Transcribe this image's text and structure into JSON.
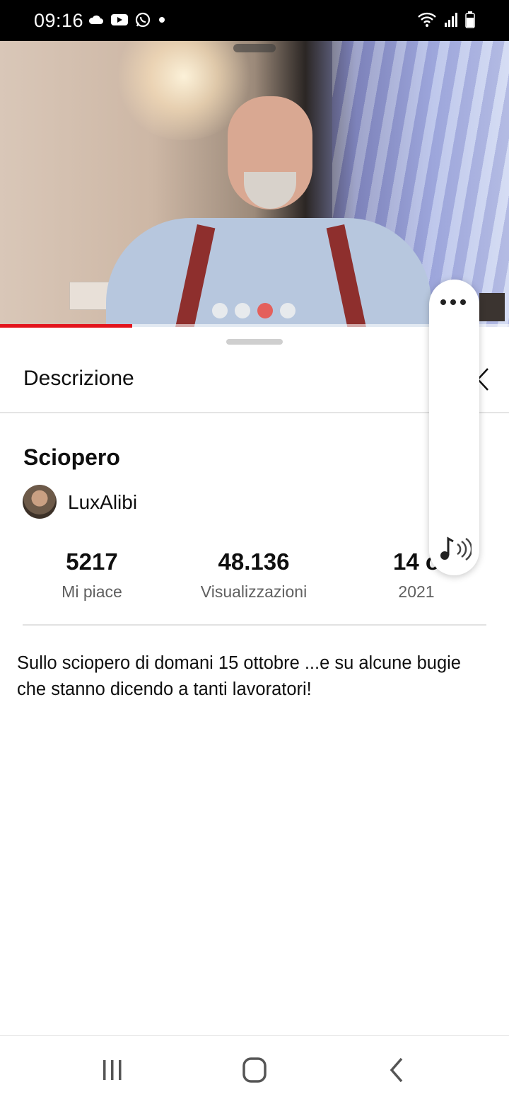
{
  "status_bar": {
    "time": "09:16",
    "left_icons": [
      "cloud-icon",
      "youtube-icon",
      "whatsapp-icon",
      "dot-icon"
    ],
    "right_icons": [
      "wifi-icon",
      "signal-icon",
      "battery-icon"
    ]
  },
  "video": {
    "progress": 0.26,
    "progress_color": "#e3141c"
  },
  "sheet": {
    "title": "Descrizione",
    "close_icon": "close-icon"
  },
  "details": {
    "video_title": "Sciopero",
    "channel_name": "LuxAlibi",
    "stats": [
      {
        "value": "5217",
        "label": "Mi piace"
      },
      {
        "value": "48.136",
        "label": "Visualizzazioni"
      },
      {
        "value": "14 o",
        "label": "2021"
      }
    ],
    "description": "Sullo sciopero di domani 15 ottobre ...e su alcune bugie che stanno dicendo a tanti lavoratori!"
  },
  "floating_panel": {
    "top_icon": "more-dots-icon",
    "bottom_icon": "sound-music-icon"
  },
  "nav_bar": {
    "buttons": [
      "recents-icon",
      "home-icon",
      "back-icon"
    ]
  }
}
